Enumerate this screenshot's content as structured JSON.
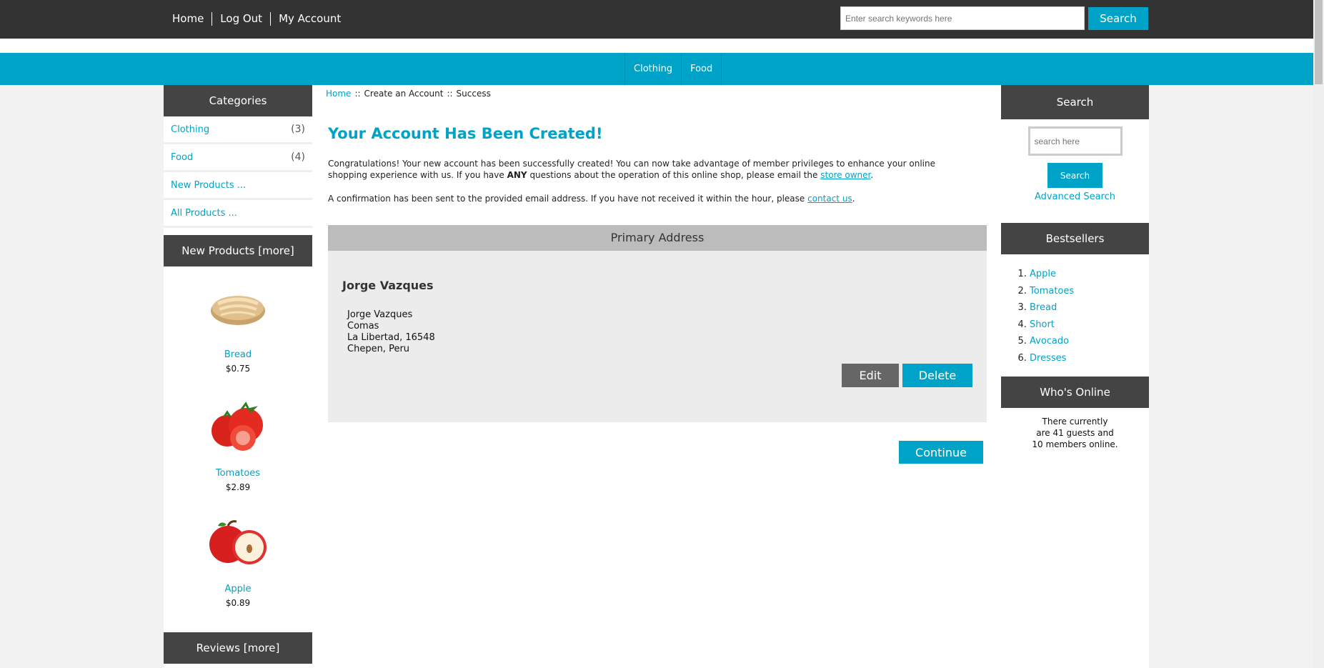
{
  "topnav": {
    "items": [
      "Home",
      "Log Out",
      "My Account"
    ]
  },
  "top_search": {
    "placeholder": "Enter search keywords here",
    "button": "Search"
  },
  "catbar": {
    "items": [
      "Clothing",
      "Food"
    ]
  },
  "categories": {
    "title": "Categories",
    "items": [
      {
        "label": "Clothing",
        "count": "(3)"
      },
      {
        "label": "Food",
        "count": "(4)"
      },
      {
        "label": "New Products ...",
        "count": ""
      },
      {
        "label": "All Products ...",
        "count": ""
      }
    ]
  },
  "new_products": {
    "title": "New Products  [more]",
    "items": [
      {
        "name": "Bread",
        "price": "$0.75"
      },
      {
        "name": "Tomatoes",
        "price": "$2.89"
      },
      {
        "name": "Apple",
        "price": "$0.89"
      }
    ]
  },
  "reviews": {
    "title": "Reviews  [more]"
  },
  "breadcrumb": {
    "home": "Home",
    "sep": "::",
    "step2": "Create an Account",
    "step3": "Success"
  },
  "page": {
    "title": "Your Account Has Been Created!",
    "msg_part1": "Congratulations! Your new account has been successfully created! You can now take advantage of member privileges to enhance your online shopping experience with us. If you have ",
    "msg_bold": "ANY",
    "msg_part2": " questions about the operation of this online shop, please email the ",
    "msg_link": "store owner",
    "msg_end": ".",
    "msg2_text": "A confirmation has been sent to the provided email address. If you have not received it within the hour, please ",
    "msg2_link": "contact us",
    "msg2_end": "."
  },
  "address": {
    "title": "Primary Address",
    "name": "Jorge Vazques",
    "lines": [
      "Jorge Vazques",
      "Comas",
      "La Libertad, 16548",
      "Chepen, Peru"
    ],
    "edit": "Edit",
    "delete": "Delete"
  },
  "continue": "Continue",
  "side_search": {
    "title": "Search",
    "placeholder": "search here",
    "button": "Search",
    "advanced": "Advanced Search"
  },
  "bestsellers": {
    "title": "Bestsellers",
    "items": [
      "Apple",
      "Tomatoes",
      "Bread",
      "Short",
      "Avocado",
      "Dresses"
    ]
  },
  "whos_online": {
    "title": "Who's Online",
    "lines": [
      "There currently",
      "are 41 guests and",
      "10 members online."
    ]
  },
  "colors": {
    "accent": "#00a3c8",
    "dark": "#333333",
    "panel": "#444444"
  }
}
